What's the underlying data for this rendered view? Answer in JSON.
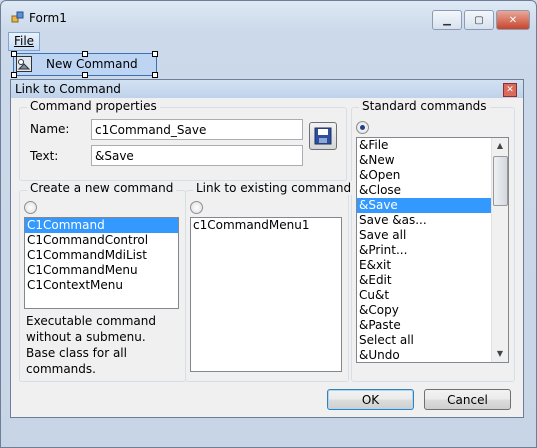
{
  "window": {
    "title": "Form1"
  },
  "menu": {
    "file": "File"
  },
  "new_command_item": {
    "label": "New Command"
  },
  "dialog": {
    "title": "Link to Command",
    "close_glyph": "✕",
    "command_properties": {
      "legend": "Command properties",
      "name_label": "Name:",
      "name_value": "c1Command_Save",
      "text_label": "Text:",
      "text_value": "&Save"
    },
    "create_new": {
      "legend": "Create a new command",
      "items": [
        "C1Command",
        "C1CommandControl",
        "C1CommandMdiList",
        "C1CommandMenu",
        "C1ContextMenu"
      ],
      "selected_index": 0,
      "description": "Executable command without a submenu. Base class for all commands."
    },
    "link_existing": {
      "legend": "Link to existing command",
      "items": [
        "c1CommandMenu1"
      ]
    },
    "standard": {
      "legend": "Standard commands",
      "items": [
        "&File",
        "&New",
        "&Open",
        "&Close",
        "&Save",
        "Save &as...",
        "Save all",
        "&Print...",
        "E&xit",
        "&Edit",
        "Cu&t",
        "&Copy",
        "&Paste",
        "Select all",
        "&Undo"
      ],
      "selected_index": 4
    },
    "buttons": {
      "ok": "OK",
      "cancel": "Cancel"
    }
  }
}
